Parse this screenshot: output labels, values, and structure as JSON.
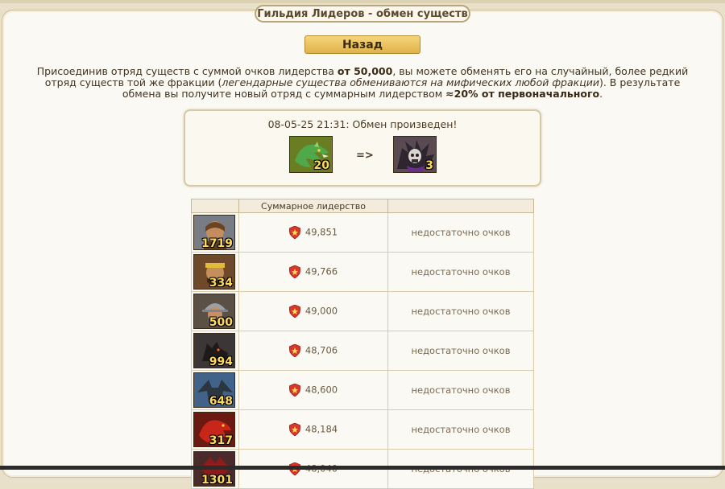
{
  "page": {
    "title": "Гильдия Лидеров - обмен существ",
    "back_label": "Назад"
  },
  "description": {
    "p1": "Присоединив отряд существ с суммой очков лидерства ",
    "p1_bold": "от 50,000",
    "p2": ", вы можете обменять его на случайный, более редкий отряд существ той же фракции (",
    "p2_italic": "легендарные существа обмениваются на мифических любой фракции",
    "p3": "). В результате обмена вы получите новый отряд с суммарным лидерством ",
    "p3_bold": "≈20% от первоначального",
    "p4": "."
  },
  "exchange_result": {
    "text": "08-05-25 21:31: Обмен произведен!",
    "from_count": "20",
    "arrow": "=>",
    "to_count": "3",
    "from_icon": "green-dragon-icon",
    "to_icon": "bone-dragon-icon"
  },
  "table": {
    "header_leadership": "Суммарное лидерство",
    "rows": [
      {
        "count": "1719",
        "leadership": "49,851",
        "status": "недостаточно очков",
        "icon": "peasant-unit-icon",
        "bg": "#6b6f78"
      },
      {
        "count": "334",
        "leadership": "49,766",
        "status": "недостаточно очков",
        "icon": "brawler-unit-icon",
        "bg": "#6e4a2b"
      },
      {
        "count": "500",
        "leadership": "49,000",
        "status": "недостаточно очков",
        "icon": "footman-unit-icon",
        "bg": "#5a5046"
      },
      {
        "count": "994",
        "leadership": "48,706",
        "status": "недостаточно очков",
        "icon": "hellhound-unit-icon",
        "bg": "#3b3434"
      },
      {
        "count": "648",
        "leadership": "48,600",
        "status": "недостаточно очков",
        "icon": "gargoyle-unit-icon",
        "bg": "#3d5f82"
      },
      {
        "count": "317",
        "leadership": "48,184",
        "status": "недостаточно очков",
        "icon": "red-dragon-unit-icon",
        "bg": "#7a1e12"
      },
      {
        "count": "1301",
        "leadership": "48,040",
        "status": "недостаточно очков",
        "icon": "demon-unit-icon",
        "bg": "#4a2a2a"
      }
    ]
  },
  "colors": {
    "panel_bg": "#fbf9f3",
    "accent_gold": "#e1b24a",
    "count_text": "#ffd95a",
    "shield_red": "#d8372a"
  }
}
